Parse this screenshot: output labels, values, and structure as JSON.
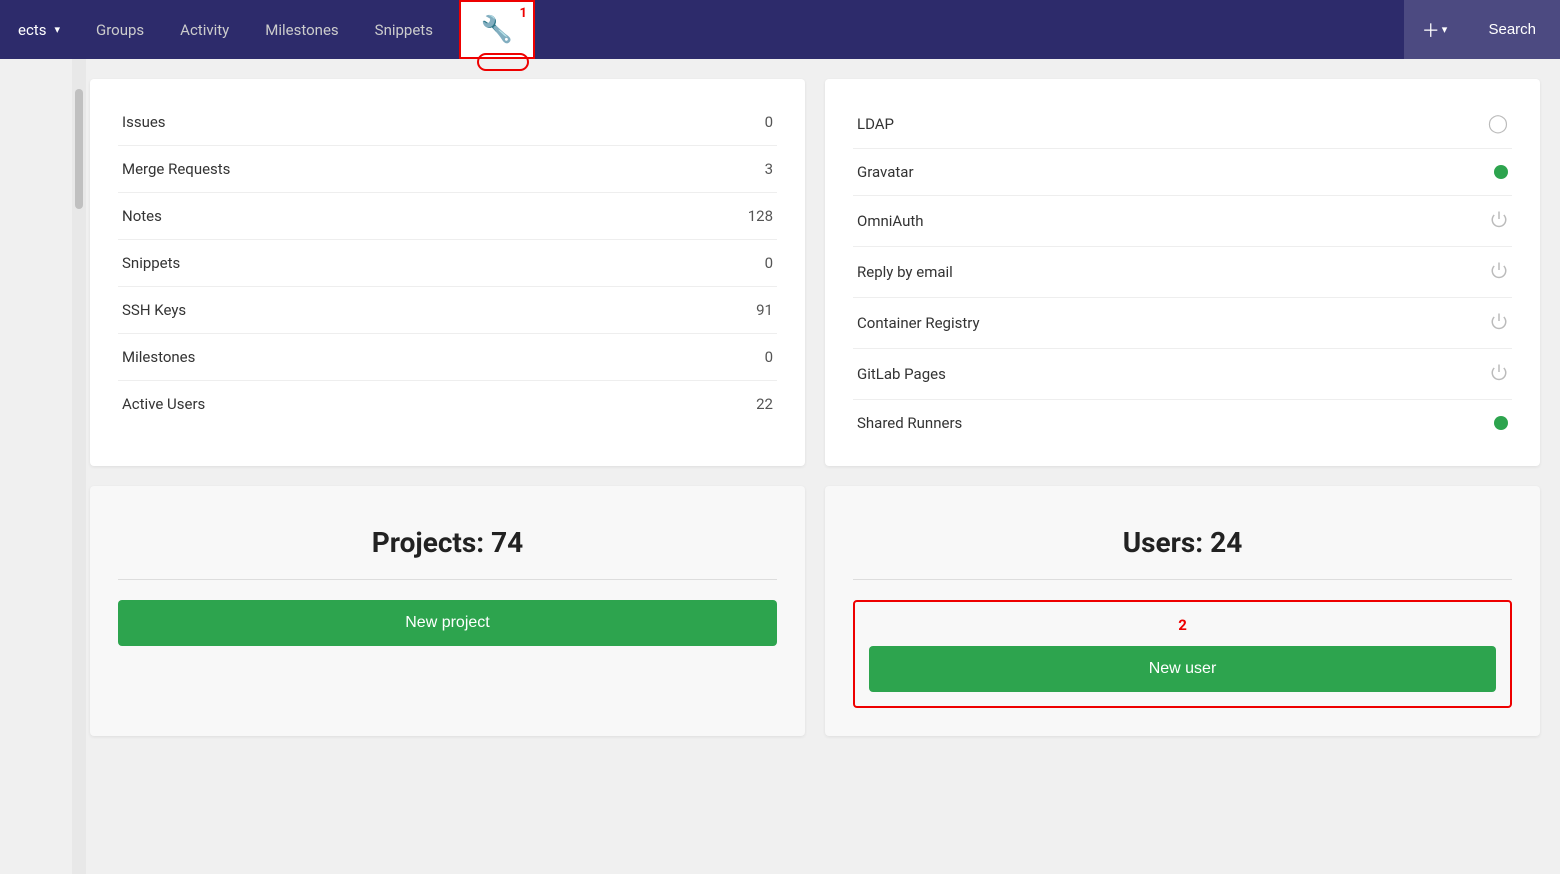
{
  "nav": {
    "projects_label": "ects",
    "groups_label": "Groups",
    "activity_label": "Activity",
    "milestones_label": "Milestones",
    "snippets_label": "Snippets",
    "search_label": "Search",
    "annotation_1": "1"
  },
  "left_card": {
    "rows": [
      {
        "label": "Issues",
        "value": "0"
      },
      {
        "label": "Merge Requests",
        "value": "3"
      },
      {
        "label": "Notes",
        "value": "128"
      },
      {
        "label": "Snippets",
        "value": "0"
      },
      {
        "label": "SSH Keys",
        "value": "91"
      },
      {
        "label": "Milestones",
        "value": "0"
      },
      {
        "label": "Active Users",
        "value": "22"
      }
    ]
  },
  "right_card": {
    "features": [
      {
        "label": "LDAP",
        "status": "off"
      },
      {
        "label": "Gravatar",
        "status": "green"
      },
      {
        "label": "OmniAuth",
        "status": "power"
      },
      {
        "label": "Reply by email",
        "status": "power"
      },
      {
        "label": "Container Registry",
        "status": "power"
      },
      {
        "label": "GitLab Pages",
        "status": "power"
      },
      {
        "label": "Shared Runners",
        "status": "green"
      }
    ]
  },
  "projects_card": {
    "title": "Projects: 74",
    "button_label": "New project"
  },
  "users_card": {
    "title": "Users: 24",
    "button_label": "New user",
    "annotation_2": "2"
  }
}
